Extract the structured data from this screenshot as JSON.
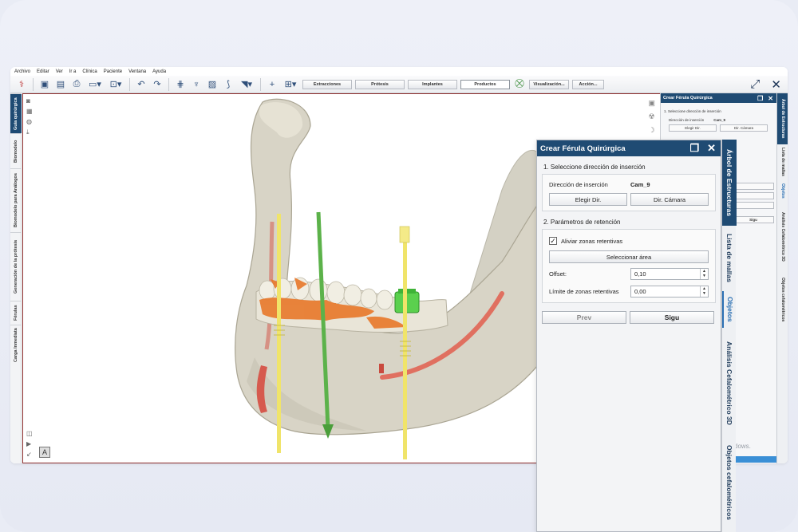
{
  "menu": [
    "Archivo",
    "Editar",
    "Ver",
    "Ir a",
    "Clínica",
    "Paciente",
    "Ventana",
    "Ayuda"
  ],
  "toolbar": {
    "buttons": [
      "Extracciones",
      "Prótesis",
      "Implantes",
      "Productos",
      "Visualización...",
      "Acción..."
    ],
    "selected": "Productos"
  },
  "left_tabs": [
    "Guía quirúrgica",
    "Biomodelo",
    "Biomodelo para Análogos",
    "Generación de la prótesis",
    "Férulas",
    "Carga Inmediata"
  ],
  "small_panel": {
    "title": "Crear Férula Quirúrgica",
    "step1": "1. Seleccione dirección de inserción",
    "dir_label": "Dirección de inserción",
    "dir_value": "Cam_9",
    "btn_elegir": "Elegir Dir.",
    "btn_camara": "Dir. Cámara",
    "next": "Sigu",
    "tabs": [
      "Árbol de Estructuras",
      "Lista de mallas",
      "Objetos",
      "Análisis Cefalométrico 3D",
      "Objetos cefalométricos"
    ]
  },
  "dialog": {
    "title": "Crear Férula Quirúrgica",
    "section1": "1. Seleccione dirección de inserción",
    "dir_label": "Dirección de inserción",
    "dir_value": "Cam_9",
    "btn_elegir": "Elegir Dir.",
    "btn_camara": "Dir. Cámara",
    "section2": "2. Parámetros de retención",
    "checkbox_label": "Aliviar zonas retentivas",
    "checkbox_checked": true,
    "btn_area": "Seleccionar área",
    "offset_label": "Offset:",
    "offset_value": "0,10",
    "limit_label": "Límite de zonas retentivas",
    "limit_value": "0,00",
    "prev": "Prev",
    "next": "Sigu"
  },
  "dialog_tabs": [
    "Árbol de Estructuras",
    "Lista de mallas",
    "Objetos",
    "Análisis Cefalométrico 3D",
    "Objetos cefalométricos"
  ],
  "watermark": "dows.",
  "viewport_badge": "A"
}
